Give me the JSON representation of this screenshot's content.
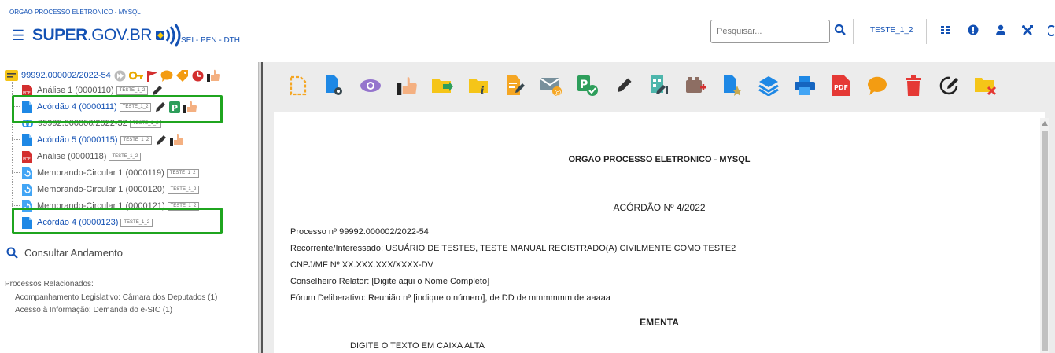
{
  "header": {
    "org_label": "ORGAO PROCESSO ELETRONICO - MYSQL",
    "logo_super": "SUPER",
    "logo_gov": ".GOV.BR",
    "system_label": "SEI - PEN - DTH",
    "search_placeholder": "Pesquisar...",
    "user_name": "TESTE_1_2"
  },
  "tree": {
    "root_label": "99992.000002/2022-54",
    "items": [
      {
        "label": "Análise 1 (0000110)",
        "tag": "TESTE_1_2",
        "icon": "pdf-icon"
      },
      {
        "label": "Acórdão 4 (0000111)",
        "tag": "TESTE_1_2",
        "icon": "document-icon"
      },
      {
        "label": "99992.000006/2022-32",
        "tag": "TESTE_1_2",
        "icon": "linked-process-icon"
      },
      {
        "label": "Acórdão 5 (0000115)",
        "tag": "TESTE_1_2",
        "icon": "document-icon"
      },
      {
        "label": "Análise (0000118)",
        "tag": "TESTE_1_2",
        "icon": "pdf-icon"
      },
      {
        "label": "Memorando-Circular 1 (0000119)",
        "tag": "TESTE_1_2",
        "icon": "circular-document-icon"
      },
      {
        "label": "Memorando-Circular 1 (0000120)",
        "tag": "TESTE_1_2",
        "icon": "circular-document-icon"
      },
      {
        "label": "Memorando-Circular 1 (0000121)",
        "tag": "TESTE_1_2",
        "icon": "circular-document-icon"
      },
      {
        "label": "Acórdão 4 (0000123)",
        "tag": "TESTE_1_2",
        "icon": "document-icon"
      }
    ]
  },
  "consult_label": "Consultar Andamento",
  "related": {
    "title": "Processos Relacionados:",
    "items": [
      "Acompanhamento Legislativo: Câmara dos Deputados (1)",
      "Acesso à Informação: Demanda do e-SIC (1)"
    ]
  },
  "toolbar_icons": [
    "new-document-icon",
    "document-settings-icon",
    "view-icon",
    "assign-icon",
    "send-process-icon",
    "folder-info-icon",
    "edit-document-icon",
    "send-email-icon",
    "sign-check-icon",
    "sign-pen-icon",
    "block-sign-icon",
    "block-add-icon",
    "document-star-icon",
    "layers-icon",
    "print-icon",
    "pdf-export-icon",
    "comment-icon",
    "delete-icon",
    "edit-circle-icon",
    "folder-remove-icon"
  ],
  "document": {
    "org": "ORGAO PROCESSO ELETRONICO - MYSQL",
    "title": "ACÓRDÃO Nº 4/2022",
    "process": "Processo nº 99992.000002/2022-54",
    "interested": "Recorrente/Interessado: USUÁRIO DE TESTES, TESTE MANUAL REGISTRADO(A) CIVILMENTE COMO TESTE2",
    "cnpj": "CNPJ/MF Nº XX.XXX.XXX/XXXX-DV",
    "reporter": "Conselheiro Relator: [Digite aqui o Nome Completo]",
    "forum": "Fórum Deliberativo: Reunião nº [indique o número], de DD de mmmmmm de aaaaa",
    "ementa": "EMENTA",
    "body": "DIGITE O TEXTO EM CAIXA ALTA"
  },
  "colors": {
    "brand_blue": "#1351b4",
    "highlight_green": "#1fa51f",
    "toolbar_orange": "#f5a623",
    "toolbar_red": "#e53935"
  }
}
